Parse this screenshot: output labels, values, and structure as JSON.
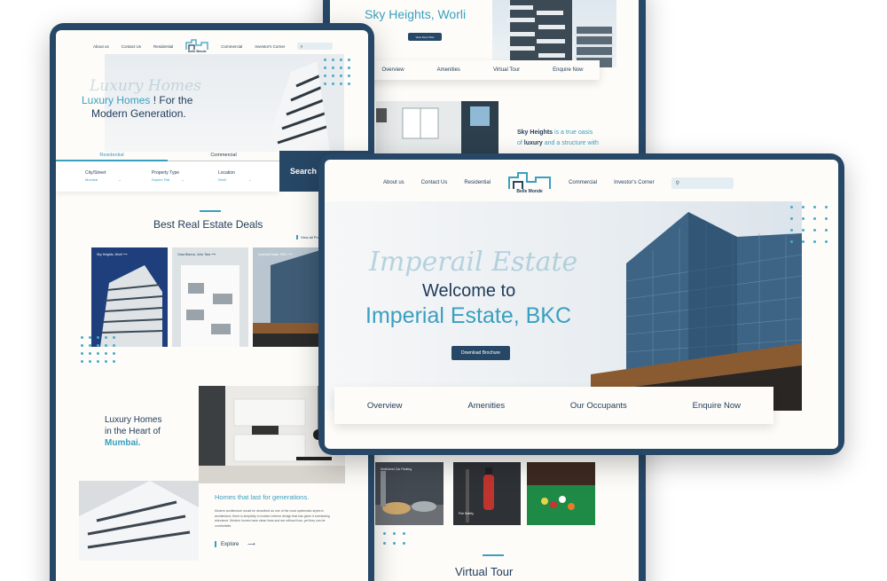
{
  "back_page": {
    "title": "Sky Heights, Worli",
    "button": "View Floor Plan",
    "tabs": [
      "Overview",
      "Amenities",
      "Virtual Tour",
      "Enquire Now"
    ],
    "desc_html_parts": {
      "brand": "Sky Heights",
      "is": " is a true oasis",
      "of": "of ",
      "luxury": "luxury",
      "rest": " and a structure with"
    },
    "gallery_labels": [
      "Multi-level Car Parking",
      "Fire Safety",
      ""
    ],
    "virtual_tour": "Virtual Tour"
  },
  "left_page": {
    "nav": [
      "About us",
      "Contact Us",
      "Residential",
      "Commercial",
      "Investor's Corner"
    ],
    "logo": "Belle Monde",
    "hero_script": "Luxury Homes",
    "hero_line1_accent": "Luxury Homes",
    "hero_line1_rest": " ! For the",
    "hero_line2": "Modern Generation.",
    "search_tabs": [
      "Residential",
      "Commercial"
    ],
    "filters": [
      {
        "label": "City/Street",
        "value": "Mumbai"
      },
      {
        "label": "Property Type",
        "value": "Duplex Flat"
      },
      {
        "label": "Location",
        "value": "Worli"
      }
    ],
    "search_button": "Search",
    "deals_title": "Best Real Estate Deals",
    "view_all": "View all Projects",
    "deal_cards": [
      "Sky Heights, Worli",
      "Casa Bianca, Juhu Tara",
      "Imperial Estate, BKC"
    ],
    "mumbai_line1": "Luxury Homes",
    "mumbai_line2": "in the Heart of",
    "mumbai_line3": "Mumbai.",
    "homes_title": "Homes that last for generations.",
    "homes_body": "Modern architecture would be described as one of the most systematic styles in architecture; there is simplicity in modern interior design that has given it everlasting relevance. Modern homes have clean lines and are without fuss, yet they can be comfortable.",
    "explore": "Explore"
  },
  "front_page": {
    "nav": [
      "About us",
      "Contact Us",
      "Residential",
      "Commercial",
      "Investor's Corner"
    ],
    "logo": "Belle Monde",
    "script": "Imperail Estate",
    "welcome": "Welcome to",
    "title": "Imperial Estate, BKC",
    "brochure_button": "Download Brochure",
    "tabs": [
      "Overview",
      "Amenities",
      "Our Occupants",
      "Enquire Now"
    ]
  },
  "colors": {
    "navy": "#274766",
    "teal": "#3a9fc0",
    "bg": "#fdfcf8"
  }
}
